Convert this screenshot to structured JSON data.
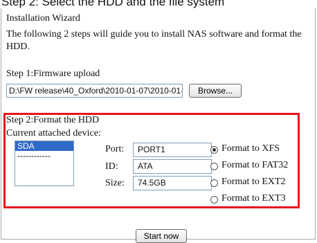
{
  "caption": "Step 2: Select the HDD and the file system",
  "wizard": {
    "title": "Installation Wizard",
    "intro": "The following 2 steps will guide you to install NAS software and format the HDD."
  },
  "step1": {
    "label": "Step 1:Firmware upload",
    "file_path": "D:\\FW release\\40_Oxford\\2010-01-07\\2010-01-",
    "browse_label": "Browse..."
  },
  "step2": {
    "label": "Step 2:Format the HDD",
    "current_device_label": "Current attached device:",
    "devices": [
      "SDA",
      "------------"
    ],
    "selected_device": "SDA",
    "port_label": "Port:",
    "port_value": "PORT1",
    "id_label": "ID:",
    "id_value": "ATA",
    "size_label": "Size:",
    "size_value": "74.5GB",
    "formats": [
      {
        "label": "Format to XFS",
        "checked": true
      },
      {
        "label": "Format to FAT32",
        "checked": false
      },
      {
        "label": "Format to EXT2",
        "checked": false
      },
      {
        "label": "Format to EXT3",
        "checked": false
      }
    ]
  },
  "actions": {
    "start_label": "Start now"
  },
  "colors": {
    "highlight_border": "#e8141b",
    "selection": "#3169c6"
  }
}
